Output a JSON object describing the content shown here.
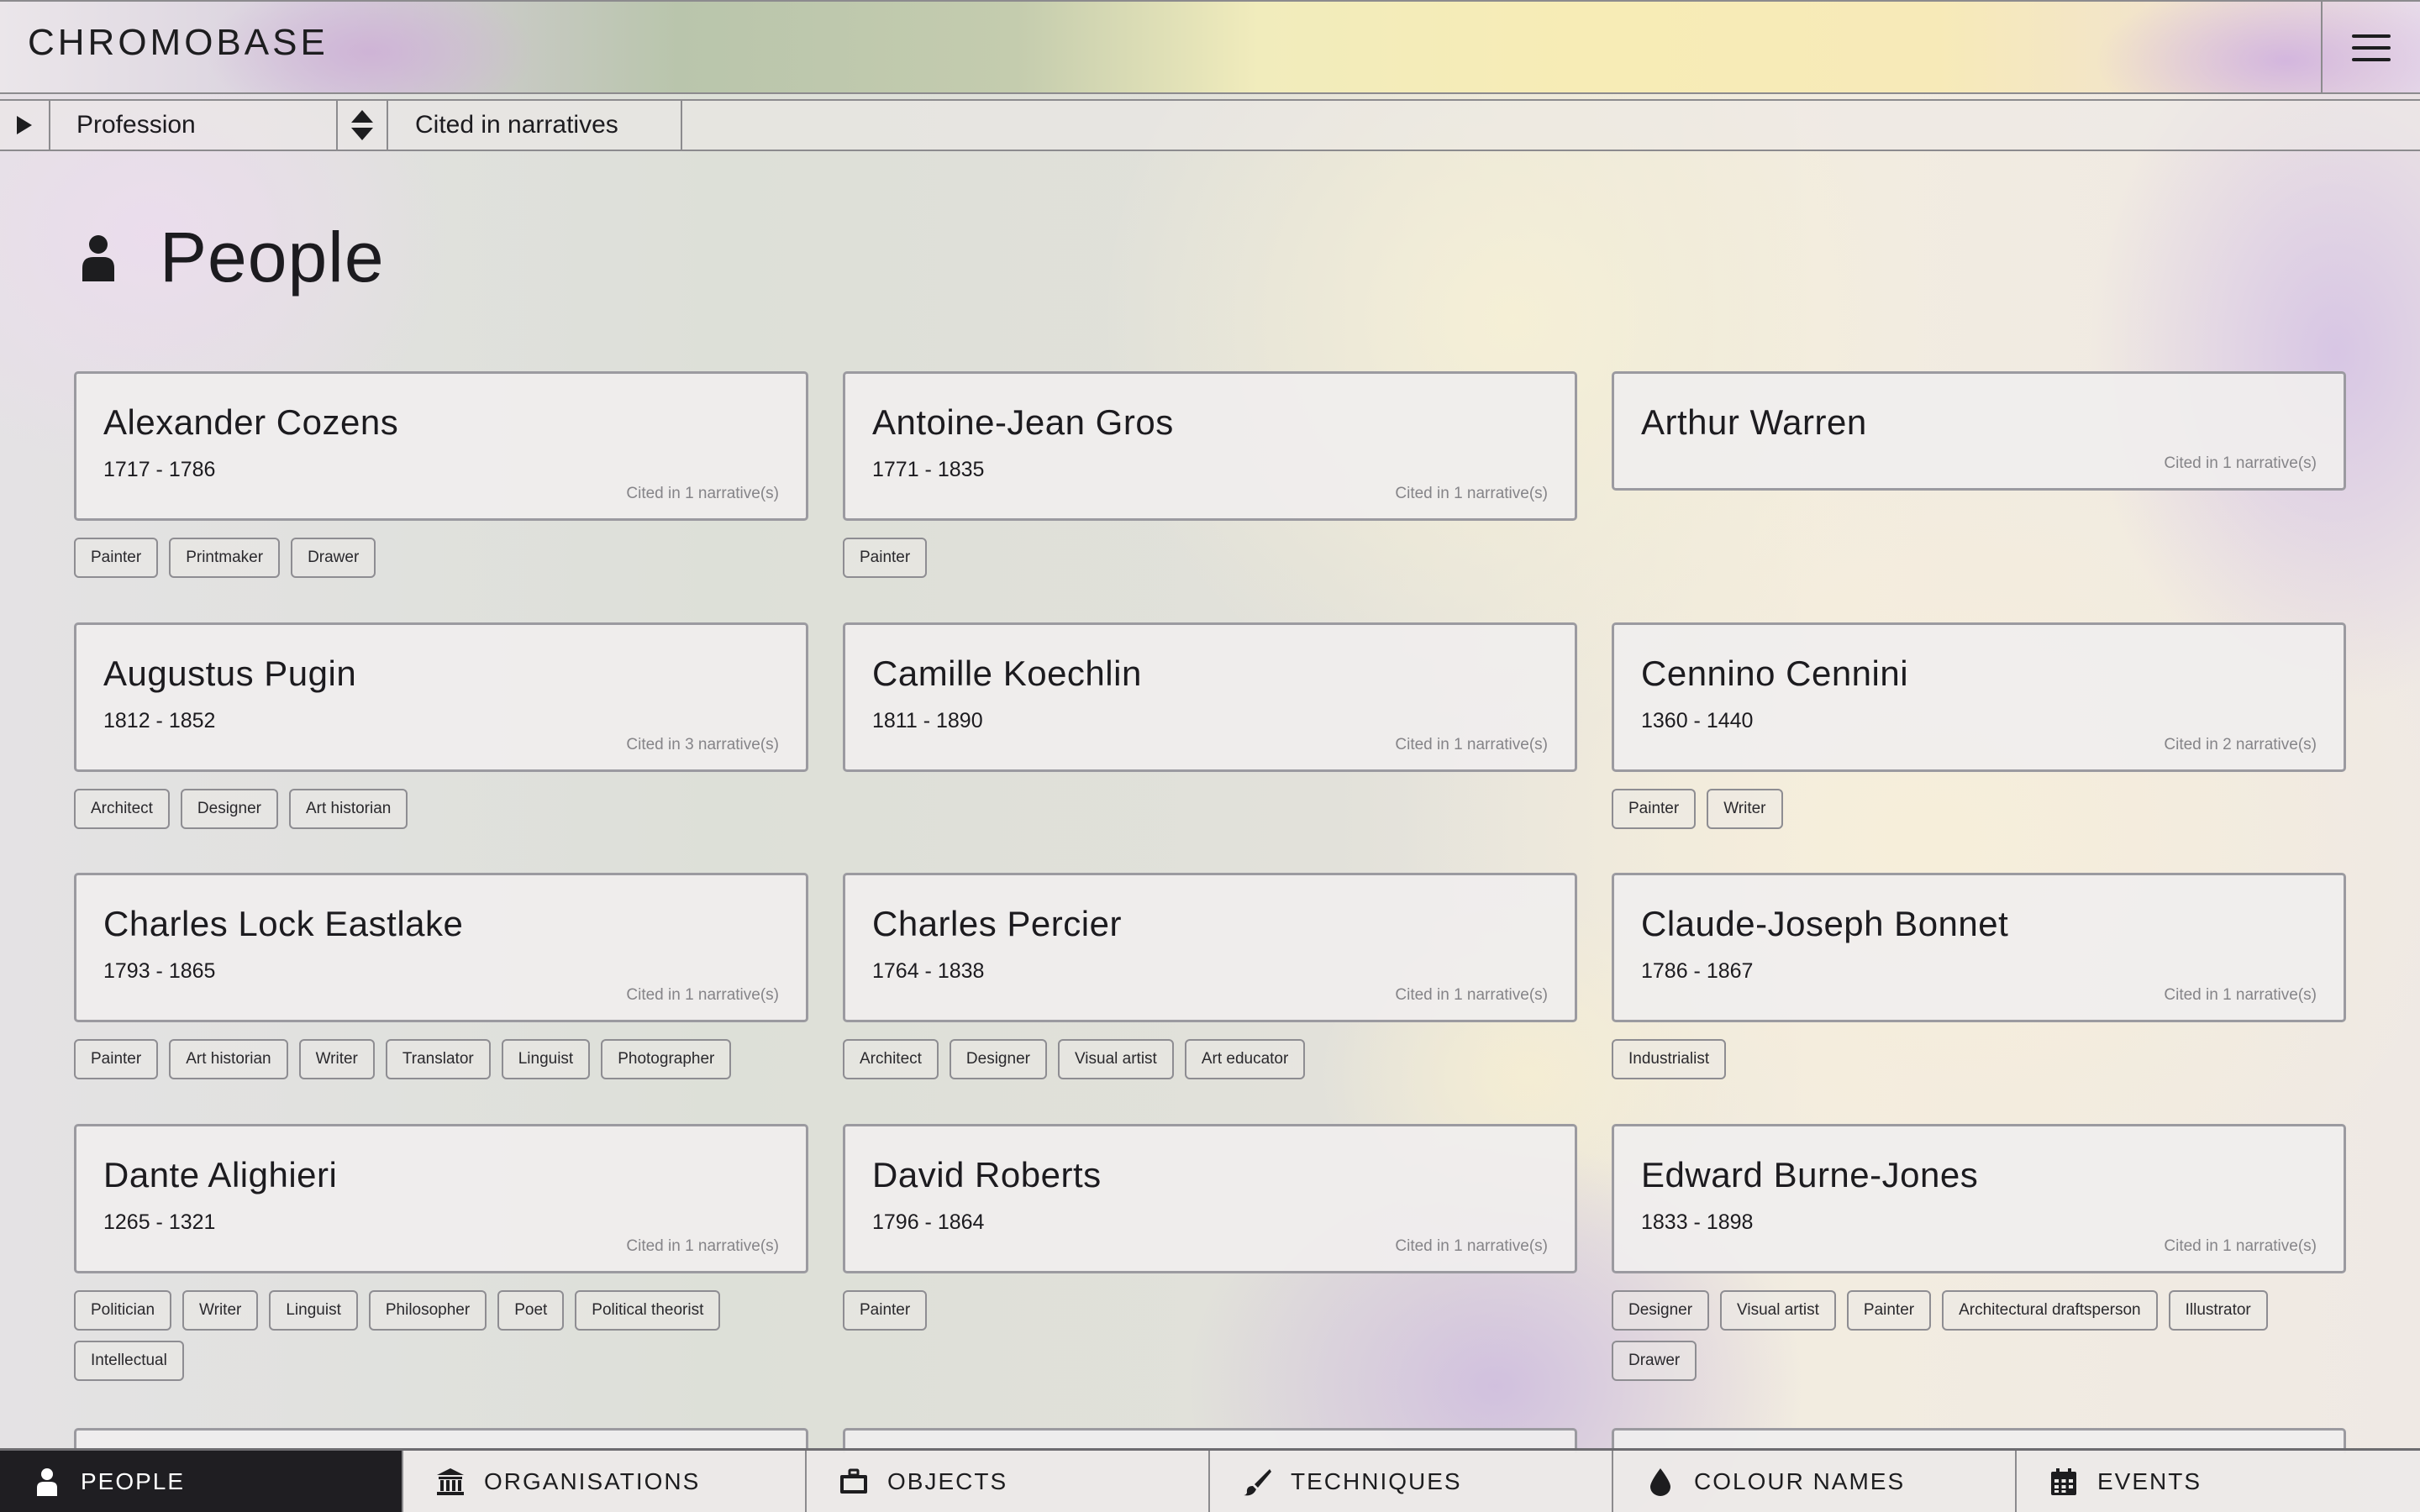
{
  "brand": "CHROMOBASE",
  "filter": {
    "profession_label": "Profession",
    "cited_label": "Cited in narratives"
  },
  "page": {
    "title": "People"
  },
  "people": [
    {
      "name": "Alexander Cozens",
      "dates": "1717 - 1786",
      "cited": "Cited in 1 narrative(s)",
      "tags": [
        "Painter",
        "Printmaker",
        "Drawer"
      ]
    },
    {
      "name": "Antoine-Jean Gros",
      "dates": "1771 - 1835",
      "cited": "Cited in 1 narrative(s)",
      "tags": [
        "Painter"
      ]
    },
    {
      "name": "Arthur Warren",
      "dates": "",
      "cited": "Cited in 1 narrative(s)",
      "tags": []
    },
    {
      "name": "Augustus Pugin",
      "dates": "1812 - 1852",
      "cited": "Cited in 3 narrative(s)",
      "tags": [
        "Architect",
        "Designer",
        "Art historian"
      ]
    },
    {
      "name": "Camille Koechlin",
      "dates": "1811 - 1890",
      "cited": "Cited in 1 narrative(s)",
      "tags": []
    },
    {
      "name": "Cennino Cennini",
      "dates": "1360 - 1440",
      "cited": "Cited in 2 narrative(s)",
      "tags": [
        "Painter",
        "Writer"
      ]
    },
    {
      "name": "Charles Lock Eastlake",
      "dates": "1793 - 1865",
      "cited": "Cited in 1 narrative(s)",
      "tags": [
        "Painter",
        "Art historian",
        "Writer",
        "Translator",
        "Linguist",
        "Photographer"
      ]
    },
    {
      "name": "Charles Percier",
      "dates": "1764 - 1838",
      "cited": "Cited in 1 narrative(s)",
      "tags": [
        "Architect",
        "Designer",
        "Visual artist",
        "Art educator"
      ]
    },
    {
      "name": "Claude-Joseph Bonnet",
      "dates": "1786 - 1867",
      "cited": "Cited in 1 narrative(s)",
      "tags": [
        "Industrialist"
      ]
    },
    {
      "name": "Dante Alighieri",
      "dates": "1265 - 1321",
      "cited": "Cited in 1 narrative(s)",
      "tags": [
        "Politician",
        "Writer",
        "Linguist",
        "Philosopher",
        "Poet",
        "Political theorist",
        "Intellectual"
      ]
    },
    {
      "name": "David Roberts",
      "dates": "1796 - 1864",
      "cited": "Cited in 1 narrative(s)",
      "tags": [
        "Painter"
      ]
    },
    {
      "name": "Edward Burne-Jones",
      "dates": "1833 - 1898",
      "cited": "Cited in 1 narrative(s)",
      "tags": [
        "Designer",
        "Visual artist",
        "Painter",
        "Architectural draftsperson",
        "Illustrator",
        "Drawer"
      ]
    }
  ],
  "nav": [
    {
      "label": "PEOPLE",
      "icon": "person-icon",
      "active": true
    },
    {
      "label": "ORGANISATIONS",
      "icon": "institution-icon",
      "active": false
    },
    {
      "label": "OBJECTS",
      "icon": "briefcase-icon",
      "active": false
    },
    {
      "label": "TECHNIQUES",
      "icon": "paintbrush-icon",
      "active": false
    },
    {
      "label": "COLOUR NAMES",
      "icon": "droplet-icon",
      "active": false
    },
    {
      "label": "EVENTS",
      "icon": "calendar-icon",
      "active": false
    }
  ]
}
